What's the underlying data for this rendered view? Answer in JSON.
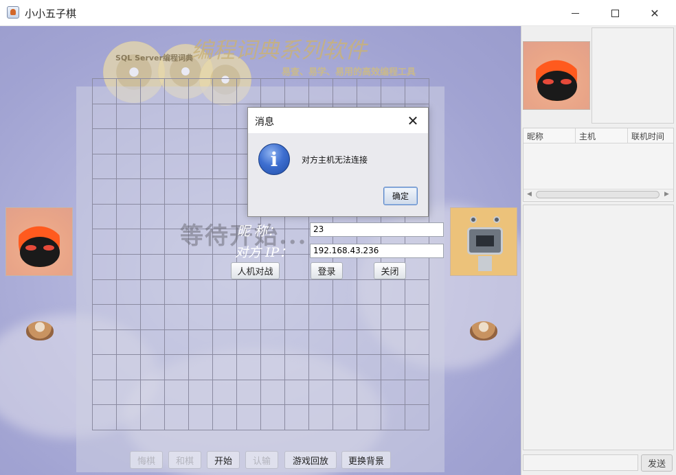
{
  "window": {
    "title": "小小五子棋",
    "minimize_icon": "minimize-icon",
    "maximize_icon": "maximize-icon",
    "close_icon": "close-icon"
  },
  "banner": {
    "title": "编程词典系列软件",
    "subtitle": "易查、易学、易用的高效编程工具",
    "cd_label": "SQL Server编程词典"
  },
  "board": {
    "overlay_text": "等待开始..."
  },
  "login": {
    "nickname_label": "昵    称：",
    "nickname_value": "23",
    "ip_label": "对方 IP：",
    "ip_value": "192.168.43.236",
    "ai_button": "人机对战",
    "login_button": "登录",
    "close_button": "关闭"
  },
  "toolbar": {
    "buttons": [
      {
        "label": "悔棋",
        "enabled": false
      },
      {
        "label": "和棋",
        "enabled": false
      },
      {
        "label": "开始",
        "enabled": true
      },
      {
        "label": "认输",
        "enabled": false
      },
      {
        "label": "游戏回放",
        "enabled": true
      },
      {
        "label": "更换背景",
        "enabled": true
      }
    ]
  },
  "sidebar": {
    "table_headers": [
      "昵称",
      "主机",
      "联机时间"
    ],
    "send_button": "发送"
  },
  "dialog": {
    "title": "消息",
    "message": "对方主机无法连接",
    "ok_button": "确定",
    "icon": "info-icon"
  },
  "colors": {
    "background": "#a9abd6",
    "dialog_bg": "#eaeaee",
    "info_blue": "#3e6fd0"
  }
}
